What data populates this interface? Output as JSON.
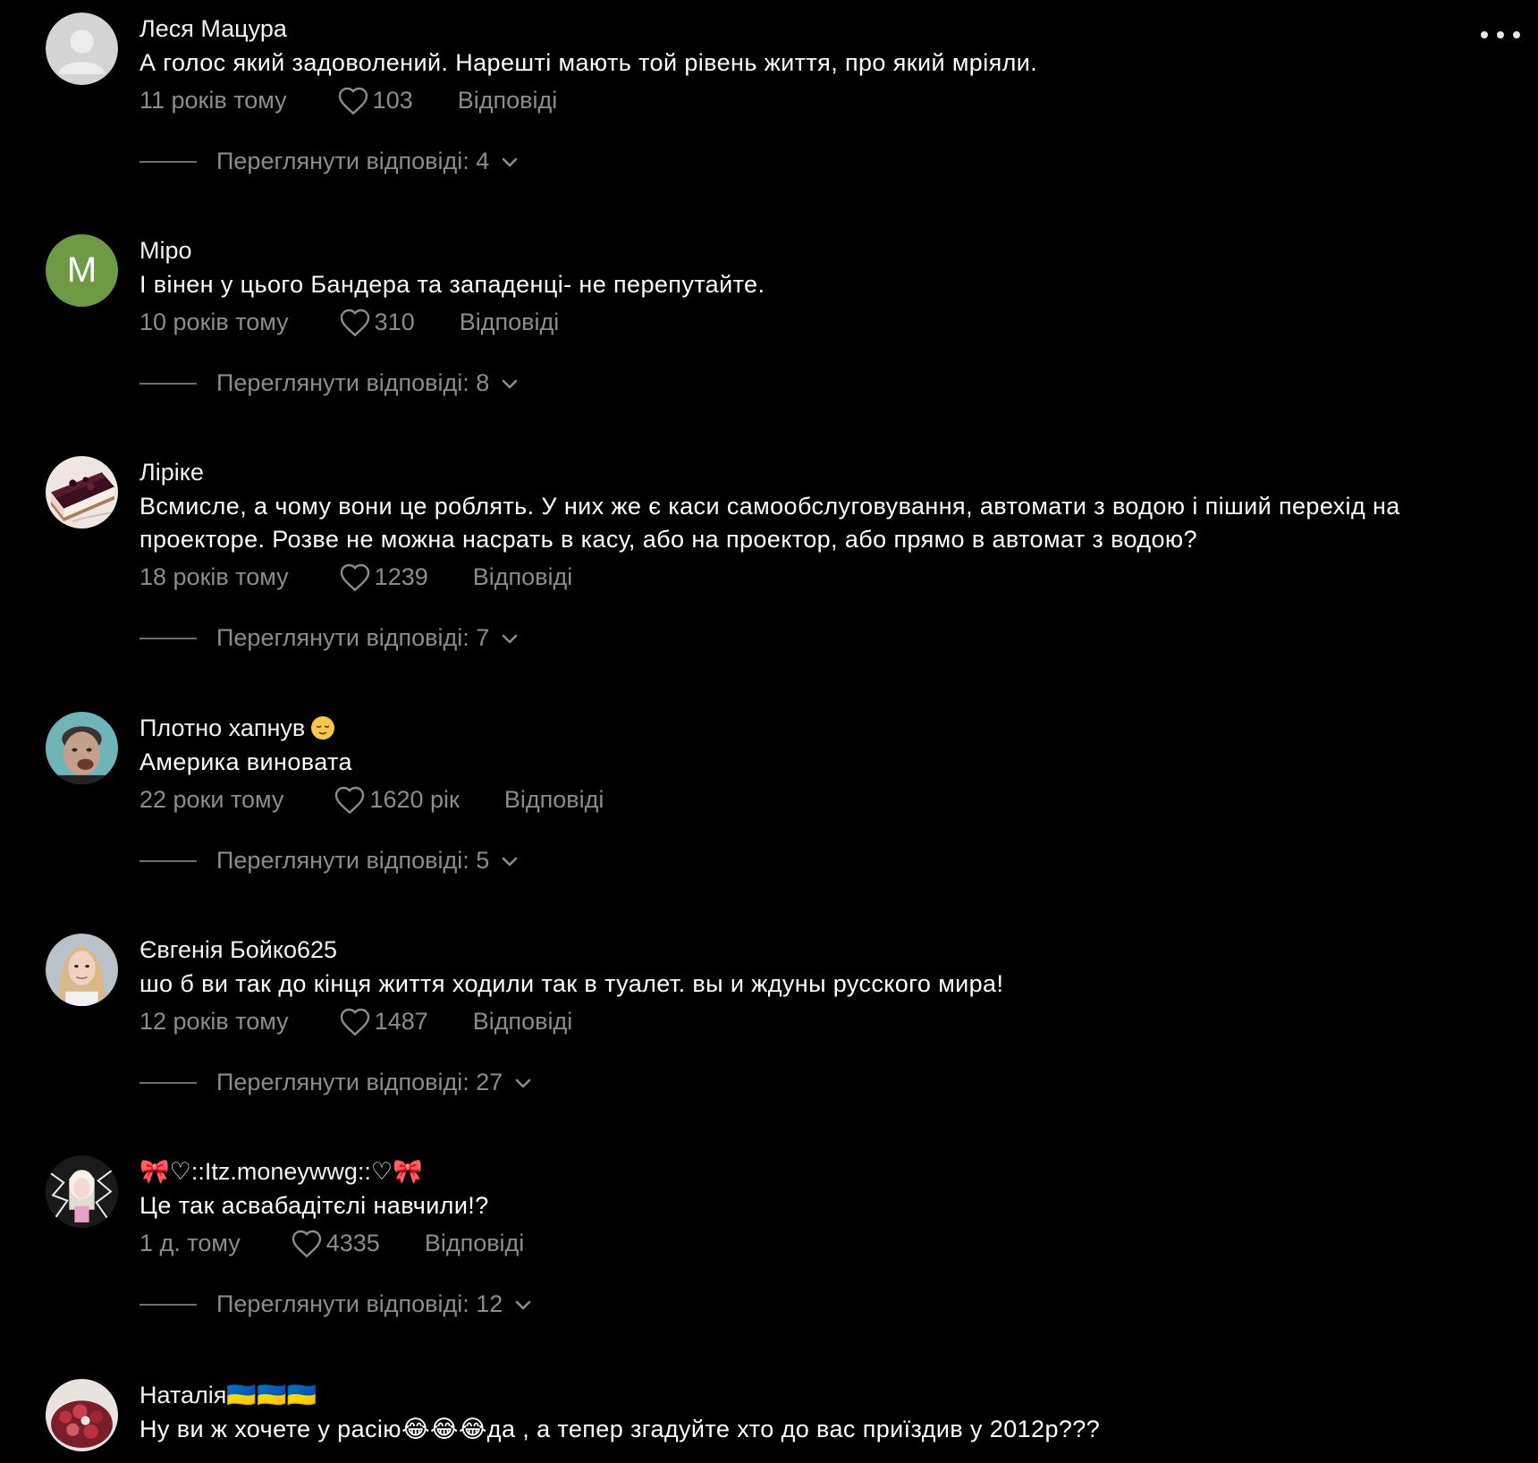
{
  "header": {
    "more_icon": "more-horizontal-icon"
  },
  "comments": [
    {
      "username": "Леся Мацура",
      "text": "А голос який задоволений. Нарешті мають той рівень життя, про який мріяли.",
      "time": "11 років тому",
      "likes": "103",
      "reply_label": "Відповіді",
      "view_replies": "Переглянути відповіді: 4",
      "avatar": "default-user-avatar"
    },
    {
      "username": "Міро",
      "text": "І вінен у цього Бандера та западенці- не перепутайте.",
      "time": "10 років тому",
      "likes": "310",
      "reply_label": "Відповіді",
      "view_replies": "Переглянути відповіді: 8",
      "avatar_letter": "M",
      "avatar_color": "#6f9a45"
    },
    {
      "username": "Ліріке",
      "text": "Всмисле, а чому вони це роблять. У них же є каси самообслуговування, автомати з водою і піший перехід на проекторе. Розве не можна насрать в касу, або на проектор, або прямо в автомат з водою?",
      "time": "18 років тому",
      "likes": "1239",
      "reply_label": "Відповіді",
      "view_replies": "Переглянути відповіді: 7",
      "avatar": "cheesecake-photo"
    },
    {
      "username": "Плотно хапнув",
      "username_emoji": "relieved-face-emoji",
      "text": "Америка виновата",
      "time": "22 роки тому",
      "likes": "1620 рік",
      "reply_label": "Відповіді",
      "view_replies": "Переглянути відповіді: 5",
      "avatar": "man-face-photo"
    },
    {
      "username": "Євгенія Бойко625",
      "text": "шо б ви так до кінця життя ходили так в туалет. вы и ждуны русского мира!",
      "time": "12 років тому",
      "likes": "1487",
      "reply_label": "Відповіді",
      "view_replies": "Переглянути відповіді: 27",
      "avatar": "woman-portrait-photo"
    },
    {
      "username": "🎀♡::Itz.moneywwg::♡🎀",
      "text": "Це так асвабадітєлі навчили!?",
      "time": "1 д. тому",
      "likes": "4335",
      "reply_label": "Відповіді",
      "view_replies": "Переглянути відповіді: 12",
      "avatar": "anime-character-photo"
    },
    {
      "username": "Наталія🇺🇦🇺🇦🇺🇦",
      "text": "Ну ви ж хочете у расію😂😂😂да , а тепер згадуйте хто до вас приїздив у 2012р???",
      "avatar": "flowers-photo"
    }
  ],
  "colors": {
    "background": "#000000",
    "text": "#ffffff",
    "muted": "#8c8c8c"
  }
}
